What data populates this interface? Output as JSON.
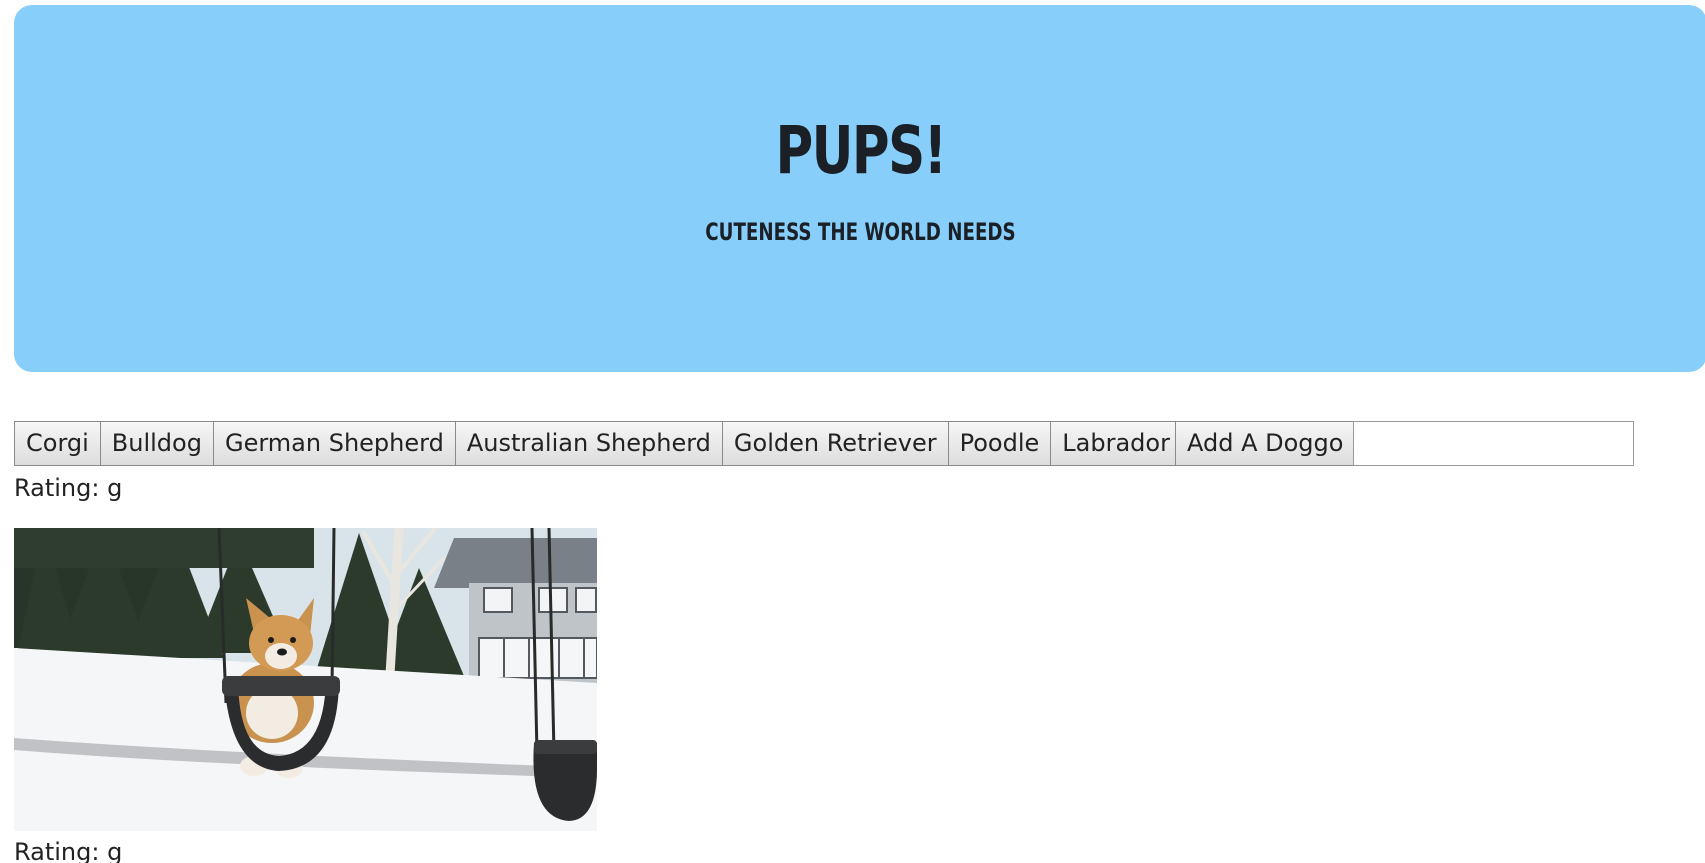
{
  "hero": {
    "title": "PUPS!",
    "subtitle": "CUTENESS THE WORLD NEEDS",
    "background_color": "#87cefa"
  },
  "breeds": [
    {
      "label": "Corgi"
    },
    {
      "label": "Bulldog"
    },
    {
      "label": "German Shepherd"
    },
    {
      "label": "Australian Shepherd"
    },
    {
      "label": "Golden Retriever"
    },
    {
      "label": "Poodle"
    },
    {
      "label": "Labrador"
    }
  ],
  "add_form": {
    "button_label": "Add A Doggo",
    "input_value": "",
    "input_placeholder": ""
  },
  "results": [
    {
      "rating_label": "Rating: g",
      "image_subject": "corgi-on-swing"
    },
    {
      "rating_label": "Rating: g"
    }
  ]
}
